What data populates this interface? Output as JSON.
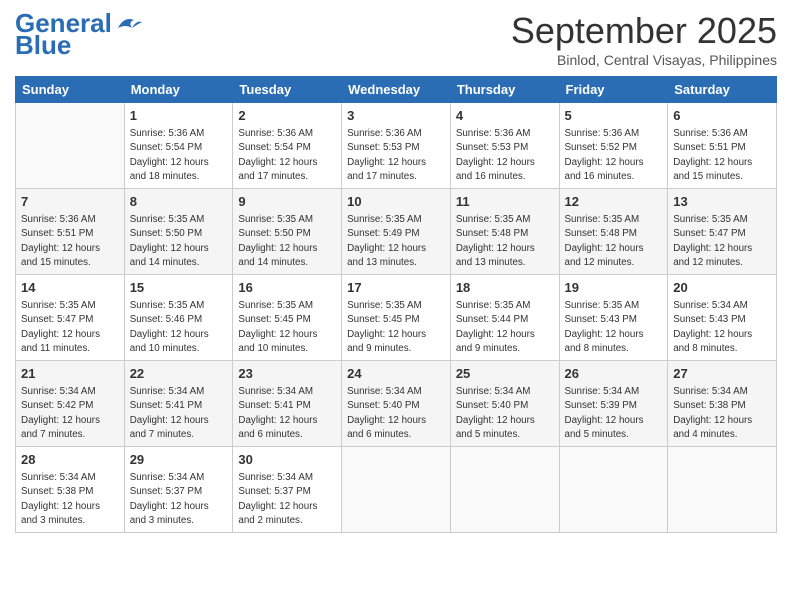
{
  "header": {
    "logo_line1": "General",
    "logo_line2": "Blue",
    "month": "September 2025",
    "location": "Binlod, Central Visayas, Philippines"
  },
  "weekdays": [
    "Sunday",
    "Monday",
    "Tuesday",
    "Wednesday",
    "Thursday",
    "Friday",
    "Saturday"
  ],
  "weeks": [
    [
      {
        "day": "",
        "info": ""
      },
      {
        "day": "1",
        "info": "Sunrise: 5:36 AM\nSunset: 5:54 PM\nDaylight: 12 hours\nand 18 minutes."
      },
      {
        "day": "2",
        "info": "Sunrise: 5:36 AM\nSunset: 5:54 PM\nDaylight: 12 hours\nand 17 minutes."
      },
      {
        "day": "3",
        "info": "Sunrise: 5:36 AM\nSunset: 5:53 PM\nDaylight: 12 hours\nand 17 minutes."
      },
      {
        "day": "4",
        "info": "Sunrise: 5:36 AM\nSunset: 5:53 PM\nDaylight: 12 hours\nand 16 minutes."
      },
      {
        "day": "5",
        "info": "Sunrise: 5:36 AM\nSunset: 5:52 PM\nDaylight: 12 hours\nand 16 minutes."
      },
      {
        "day": "6",
        "info": "Sunrise: 5:36 AM\nSunset: 5:51 PM\nDaylight: 12 hours\nand 15 minutes."
      }
    ],
    [
      {
        "day": "7",
        "info": "Sunrise: 5:36 AM\nSunset: 5:51 PM\nDaylight: 12 hours\nand 15 minutes."
      },
      {
        "day": "8",
        "info": "Sunrise: 5:35 AM\nSunset: 5:50 PM\nDaylight: 12 hours\nand 14 minutes."
      },
      {
        "day": "9",
        "info": "Sunrise: 5:35 AM\nSunset: 5:50 PM\nDaylight: 12 hours\nand 14 minutes."
      },
      {
        "day": "10",
        "info": "Sunrise: 5:35 AM\nSunset: 5:49 PM\nDaylight: 12 hours\nand 13 minutes."
      },
      {
        "day": "11",
        "info": "Sunrise: 5:35 AM\nSunset: 5:48 PM\nDaylight: 12 hours\nand 13 minutes."
      },
      {
        "day": "12",
        "info": "Sunrise: 5:35 AM\nSunset: 5:48 PM\nDaylight: 12 hours\nand 12 minutes."
      },
      {
        "day": "13",
        "info": "Sunrise: 5:35 AM\nSunset: 5:47 PM\nDaylight: 12 hours\nand 12 minutes."
      }
    ],
    [
      {
        "day": "14",
        "info": "Sunrise: 5:35 AM\nSunset: 5:47 PM\nDaylight: 12 hours\nand 11 minutes."
      },
      {
        "day": "15",
        "info": "Sunrise: 5:35 AM\nSunset: 5:46 PM\nDaylight: 12 hours\nand 10 minutes."
      },
      {
        "day": "16",
        "info": "Sunrise: 5:35 AM\nSunset: 5:45 PM\nDaylight: 12 hours\nand 10 minutes."
      },
      {
        "day": "17",
        "info": "Sunrise: 5:35 AM\nSunset: 5:45 PM\nDaylight: 12 hours\nand 9 minutes."
      },
      {
        "day": "18",
        "info": "Sunrise: 5:35 AM\nSunset: 5:44 PM\nDaylight: 12 hours\nand 9 minutes."
      },
      {
        "day": "19",
        "info": "Sunrise: 5:35 AM\nSunset: 5:43 PM\nDaylight: 12 hours\nand 8 minutes."
      },
      {
        "day": "20",
        "info": "Sunrise: 5:34 AM\nSunset: 5:43 PM\nDaylight: 12 hours\nand 8 minutes."
      }
    ],
    [
      {
        "day": "21",
        "info": "Sunrise: 5:34 AM\nSunset: 5:42 PM\nDaylight: 12 hours\nand 7 minutes."
      },
      {
        "day": "22",
        "info": "Sunrise: 5:34 AM\nSunset: 5:41 PM\nDaylight: 12 hours\nand 7 minutes."
      },
      {
        "day": "23",
        "info": "Sunrise: 5:34 AM\nSunset: 5:41 PM\nDaylight: 12 hours\nand 6 minutes."
      },
      {
        "day": "24",
        "info": "Sunrise: 5:34 AM\nSunset: 5:40 PM\nDaylight: 12 hours\nand 6 minutes."
      },
      {
        "day": "25",
        "info": "Sunrise: 5:34 AM\nSunset: 5:40 PM\nDaylight: 12 hours\nand 5 minutes."
      },
      {
        "day": "26",
        "info": "Sunrise: 5:34 AM\nSunset: 5:39 PM\nDaylight: 12 hours\nand 5 minutes."
      },
      {
        "day": "27",
        "info": "Sunrise: 5:34 AM\nSunset: 5:38 PM\nDaylight: 12 hours\nand 4 minutes."
      }
    ],
    [
      {
        "day": "28",
        "info": "Sunrise: 5:34 AM\nSunset: 5:38 PM\nDaylight: 12 hours\nand 3 minutes."
      },
      {
        "day": "29",
        "info": "Sunrise: 5:34 AM\nSunset: 5:37 PM\nDaylight: 12 hours\nand 3 minutes."
      },
      {
        "day": "30",
        "info": "Sunrise: 5:34 AM\nSunset: 5:37 PM\nDaylight: 12 hours\nand 2 minutes."
      },
      {
        "day": "",
        "info": ""
      },
      {
        "day": "",
        "info": ""
      },
      {
        "day": "",
        "info": ""
      },
      {
        "day": "",
        "info": ""
      }
    ]
  ]
}
